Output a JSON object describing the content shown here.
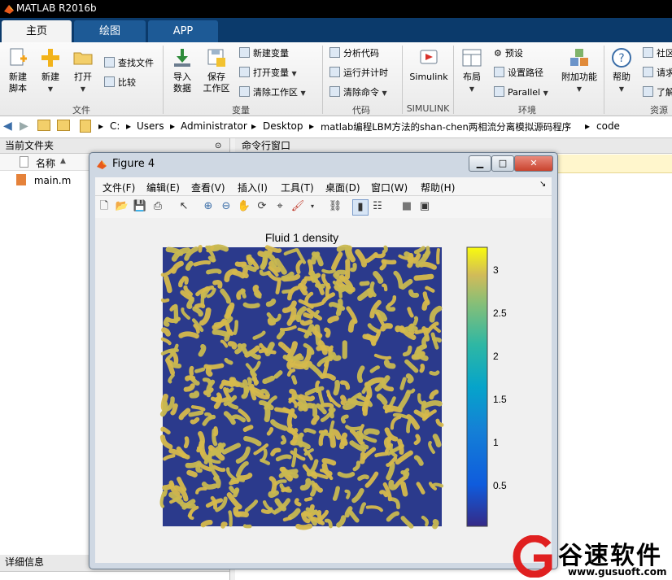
{
  "window": {
    "title": "MATLAB R2016b"
  },
  "tabs": [
    {
      "label": "主页"
    },
    {
      "label": "绘图"
    },
    {
      "label": "APP"
    }
  ],
  "ribbon": {
    "file": {
      "new_script": "新建\n脚本",
      "new": "新建",
      "open": "打开",
      "find_files": "查找文件",
      "compare": "比较",
      "group": "文件"
    },
    "variable": {
      "import": "导入\n数据",
      "save_workspace": "保存\n工作区",
      "new_variable": "新建变量",
      "open_variable": "打开变量",
      "clear_workspace": "清除工作区",
      "group": "变量"
    },
    "code": {
      "analyze": "分析代码",
      "run_time": "运行并计时",
      "clear_commands": "清除命令",
      "group": "代码"
    },
    "simulink": {
      "label": "Simulink",
      "group": "SIMULINK"
    },
    "environment": {
      "layout": "布局",
      "preferences": "预设",
      "set_path": "设置路径",
      "parallel": "Parallel",
      "addons": "附加功能",
      "group": "环境"
    },
    "resources": {
      "help": "帮助",
      "community": "社区",
      "request": "请求",
      "learn": "了解",
      "group": "资源"
    }
  },
  "address": {
    "path": [
      "C:",
      "Users",
      "Administrator",
      "Desktop",
      "matlab编程LBM方法的shan-chen两相流分离模拟源码程序",
      "code"
    ]
  },
  "current_folder": {
    "header": "当前文件夹",
    "column": "名称",
    "files": [
      "main.m"
    ],
    "details": "详细信息"
  },
  "command_window": {
    "header": "命令行窗口"
  },
  "figure": {
    "title": "Figure 4",
    "menu": [
      "文件(F)",
      "编辑(E)",
      "查看(V)",
      "插入(I)",
      "工具(T)",
      "桌面(D)",
      "窗口(W)",
      "帮助(H)"
    ],
    "plot_title": "Fluid 1 density",
    "colorbar_ticks": [
      "3",
      "2.5",
      "2",
      "1.5",
      "1",
      "0.5"
    ],
    "colormap": "parula"
  },
  "watermark": {
    "name": "谷速软件",
    "url": "www.gusuoft.com"
  },
  "colors": {
    "title_bar": "#000000",
    "tab_strip": "#0b3a6b",
    "ribbon": "#f0f0f0",
    "cmd_banner": "#fff6cc"
  }
}
